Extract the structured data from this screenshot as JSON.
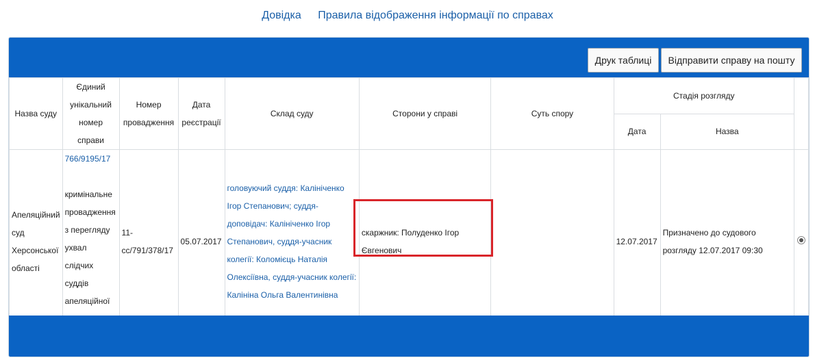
{
  "top_links": [
    "Довідка",
    "Правила відображення інформації по справах"
  ],
  "buttons": {
    "print": "Друк таблиці",
    "send": "Відправити справу на пошту"
  },
  "headers": {
    "court": "Назва суду",
    "case_number": "Єдиний унікальний номер справи",
    "proceeding": "Номер провадження",
    "reg_date": "Дата реєстрації",
    "composition": "Склад суду",
    "parties": "Сторони у справі",
    "essence": "Суть спору",
    "stage": "Стадія розгляду",
    "stage_date": "Дата",
    "stage_name": "Назва"
  },
  "row": {
    "court": "Апеляційний суд Херсонської області",
    "case_number": "766/9195/17",
    "case_description": "кримінальне провадження з перегляду ухвал слідчих суддів апеляційної інстанцією",
    "proceeding": "11-cc/791/378/17",
    "reg_date": "05.07.2017",
    "composition": "головуючий суддя: Калініченко Ігор Степанович; суддя-доповідач: Калініченко Ігор Степанович, суддя-учасник колегії: Коломієць Наталія Олексіївна, суддя-учасник колегії: Калініна Ольга Валентинівна",
    "parties": "скаржник: Полуденко Ігор Євгенович",
    "essence": "",
    "stage_date": "12.07.2017",
    "stage_name": "Призначено до судового розгляду 12.07.2017 09:30"
  },
  "colors": {
    "header_bar": "#0a63c4",
    "link": "#1a5fa8",
    "highlight": "#d9252a"
  }
}
